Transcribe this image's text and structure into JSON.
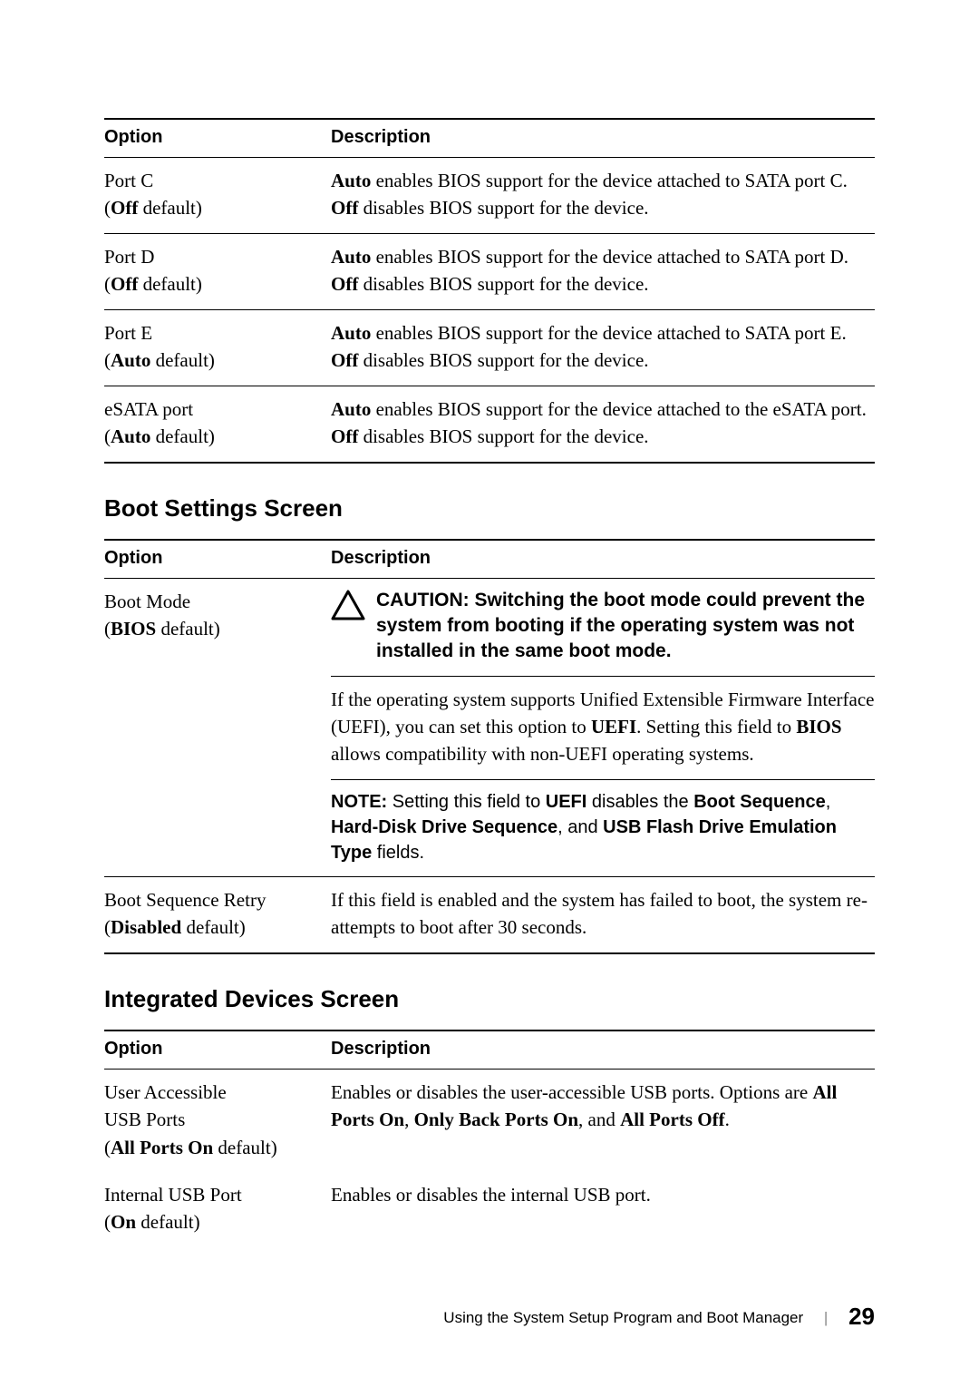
{
  "table1": {
    "head_opt": "Option",
    "head_desc": "Description",
    "rows": [
      {
        "opt_line1": "Port C",
        "opt_default_pre": "(",
        "opt_default_b": "Off",
        "opt_default_post": " default)",
        "d_pre1": "",
        "d_b1": "Auto",
        "d_mid1": " enables BIOS support for the device attached to SATA port C. ",
        "d_b2": "Off",
        "d_post1": " disables BIOS support for the device."
      },
      {
        "opt_line1": "Port D",
        "opt_default_pre": "(",
        "opt_default_b": "Off",
        "opt_default_post": " default)",
        "d_pre1": "",
        "d_b1": "Auto",
        "d_mid1": " enables BIOS support for the device attached to SATA port D. ",
        "d_b2": "Off",
        "d_post1": " disables BIOS support for the device."
      },
      {
        "opt_line1": "Port E",
        "opt_default_pre": "(",
        "opt_default_b": "Auto",
        "opt_default_post": " default)",
        "d_pre1": "",
        "d_b1": "Auto",
        "d_mid1": " enables BIOS support for the device attached to SATA port E. ",
        "d_b2": "Off",
        "d_post1": " disables BIOS support for the device."
      },
      {
        "opt_line1": "eSATA port",
        "opt_default_pre": "(",
        "opt_default_b": "Auto",
        "opt_default_post": " default)",
        "d_pre1": "",
        "d_b1": "Auto",
        "d_mid1": " enables BIOS support for the device attached to the eSATA port. ",
        "d_b2": "Off",
        "d_post1": " disables BIOS support for the device."
      }
    ]
  },
  "heading2": "Boot Settings Screen",
  "table2": {
    "head_opt": "Option",
    "head_desc": "Description",
    "row1": {
      "opt_line1": "Boot Mode",
      "opt_default_pre": "(",
      "opt_default_b": "BIOS",
      "opt_default_post": " default)",
      "caution_lead": "CAUTION: ",
      "caution_text": "Switching the boot mode could prevent the system from booting if the operating system was not installed in the same boot mode.",
      "para2_pre": "If the operating system supports Unified Extensible Firmware Interface (UEFI), you can set this option to ",
      "para2_b1": "UEFI",
      "para2_mid": ". Setting this field to ",
      "para2_b2": "BIOS",
      "para2_post": " allows compatibility with non-UEFI operating systems.",
      "note_lead": "NOTE: ",
      "note_text_pre": "Setting this field to ",
      "note_b1": "UEFI",
      "note_mid1": " disables the ",
      "note_b2": "Boot Sequence",
      "note_mid2": ", ",
      "note_b3": "Hard-Disk Drive Sequence",
      "note_mid3": ", and ",
      "note_b4": "USB Flash Drive Emulation Type",
      "note_post": " fields."
    },
    "row2": {
      "opt_line1": "Boot Sequence Retry",
      "opt_default_pre": "(",
      "opt_default_b": "Disabled",
      "opt_default_post": " default)",
      "desc": "If this field is enabled and the system has failed to boot, the system re-attempts to boot after 30 seconds."
    }
  },
  "heading3": "Integrated Devices Screen",
  "table3": {
    "head_opt": "Option",
    "head_desc": "Description",
    "row1": {
      "opt_l1": "User Accessible",
      "opt_l2": "USB Ports",
      "opt_default_pre": "(",
      "opt_default_b": "All Ports On",
      "opt_default_post": " default)",
      "d_pre": "Enables or disables the user-accessible USB ports. Options are ",
      "d_b1": "All Ports On",
      "d_m1": ", ",
      "d_b2": "Only Back Ports On",
      "d_m2": ", and ",
      "d_b3": "All Ports Off",
      "d_post": "."
    },
    "row2": {
      "opt_l1": "Internal USB Port",
      "opt_default_pre": "(",
      "opt_default_b": "On",
      "opt_default_post": " default)",
      "desc": "Enables or disables the internal USB port."
    }
  },
  "footer": {
    "title": "Using the System Setup Program and Boot Manager",
    "page": "29"
  }
}
